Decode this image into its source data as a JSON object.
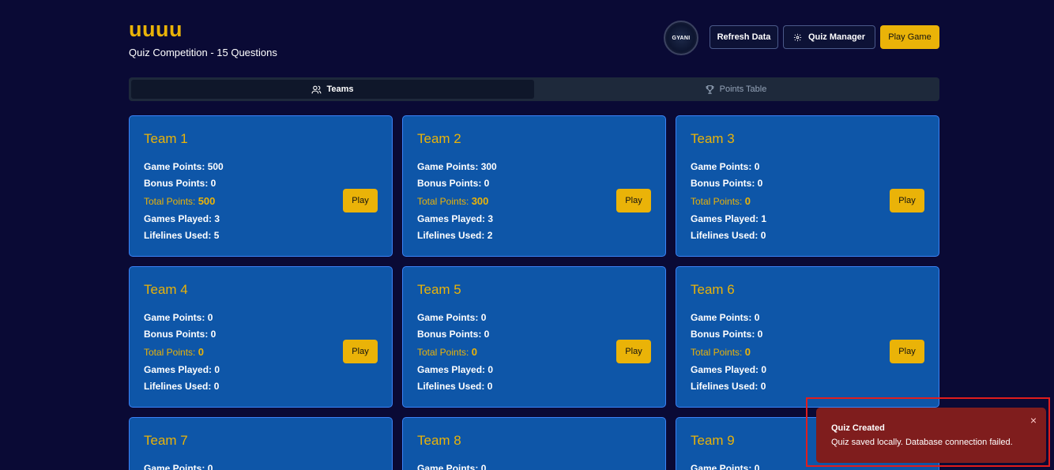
{
  "header": {
    "title": "uuuu",
    "subtitle": "Quiz Competition - 15 Questions",
    "logo_text": "GYANI",
    "logo_icon": "logo-badge",
    "refresh_label": "Refresh Data",
    "manager_label": "Quiz Manager",
    "manager_icon": "gear-icon",
    "play_game_label": "Play Game"
  },
  "tabs": [
    {
      "label": "Teams",
      "icon": "users-icon",
      "active": true
    },
    {
      "label": "Points Table",
      "icon": "trophy-icon",
      "active": false
    }
  ],
  "labels": {
    "game_points": "Game Points: ",
    "bonus_points": "Bonus Points: ",
    "total_points": "Total Points: ",
    "games_played": "Games Played: ",
    "lifelines_used": "Lifelines Used: ",
    "play": "Play"
  },
  "teams": [
    {
      "name": "Team 1",
      "game_points": "500",
      "bonus_points": "0",
      "total_points": "500",
      "games_played": "3",
      "lifelines_used": "5"
    },
    {
      "name": "Team 2",
      "game_points": "300",
      "bonus_points": "0",
      "total_points": "300",
      "games_played": "3",
      "lifelines_used": "2"
    },
    {
      "name": "Team 3",
      "game_points": "0",
      "bonus_points": "0",
      "total_points": "0",
      "games_played": "1",
      "lifelines_used": "0"
    },
    {
      "name": "Team 4",
      "game_points": "0",
      "bonus_points": "0",
      "total_points": "0",
      "games_played": "0",
      "lifelines_used": "0"
    },
    {
      "name": "Team 5",
      "game_points": "0",
      "bonus_points": "0",
      "total_points": "0",
      "games_played": "0",
      "lifelines_used": "0"
    },
    {
      "name": "Team 6",
      "game_points": "0",
      "bonus_points": "0",
      "total_points": "0",
      "games_played": "0",
      "lifelines_used": "0"
    },
    {
      "name": "Team 7",
      "game_points": "0"
    },
    {
      "name": "Team 8",
      "game_points": "0"
    },
    {
      "name": "Team 9",
      "game_points": "0"
    }
  ],
  "toast": {
    "title": "Quiz Created",
    "message": "Quiz saved locally. Database connection failed.",
    "close_symbol": "×"
  },
  "colors": {
    "background": "#0a0a35",
    "accent": "#eab308",
    "card": "#0e56a8",
    "toast": "#7f1d1d",
    "highlight": "#e11d1d"
  }
}
